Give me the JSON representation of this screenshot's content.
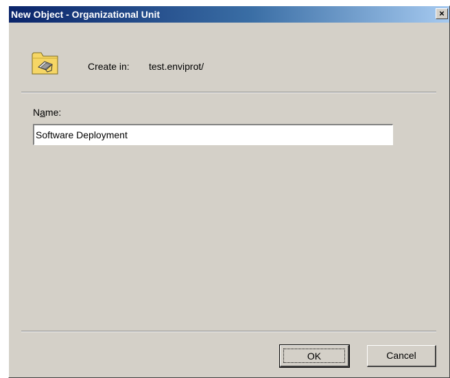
{
  "window": {
    "title": "New Object - Organizational Unit",
    "close_label": "×"
  },
  "header": {
    "icon": "organizational-unit-folder-icon",
    "create_in_label": "Create in:",
    "create_in_value": "test.enviprot/"
  },
  "form": {
    "name_label_pre": "N",
    "name_label_accel": "a",
    "name_label_post": "me:",
    "name_value": "Software Deployment"
  },
  "buttons": {
    "ok_label": "OK",
    "cancel_label": "Cancel"
  },
  "colors": {
    "dialog_face": "#d4d0c8",
    "title_active": "#0a246a",
    "folder_yellow": "#f6d665"
  }
}
